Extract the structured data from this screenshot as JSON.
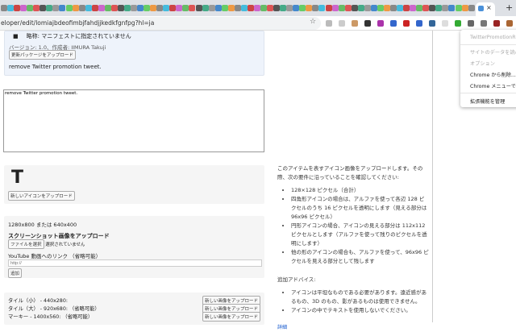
{
  "browser": {
    "url": "eloper/edit/lomiajbdeofimbjfahdjjkedkfgnfpg?hl=ja",
    "close_tab": "×",
    "new_tab": "+",
    "bookmark": "☆"
  },
  "top_panel": {
    "permission": "略称: マニフェストに指定されていません",
    "version": "バージョン: 1.0、作成者: IIMURA Takuji",
    "upload_pkg": "更新パッケージをアップロード",
    "description": "remove Twitter promotion tweet."
  },
  "textarea_value": "remove Twitter promotion tweet.",
  "icon_panel": {
    "glyph": "T",
    "upload": "新しいアイコンをアップロード"
  },
  "screenshot_panel": {
    "size": "1280x800 または 640x400",
    "heading": "スクリーンショット画像をアップロード",
    "choose_file": "ファイルを選択",
    "no_file": "選択されていません",
    "youtube_label": "YouTube 動画へのリンク （省略可能）",
    "youtube_placeholder": "http://",
    "add": "追加"
  },
  "tiles": [
    {
      "label": "タイル（小） - 440x280:",
      "button": "新しい画像をアップロード"
    },
    {
      "label": "タイル（大） - 920x680: （省略可能）",
      "button": "新しい画像をアップロード"
    },
    {
      "label": "マーキー - 1400x560: （省略可能）",
      "button": "新しい画像をアップロード"
    }
  ],
  "help": {
    "intro": "このアイテムを表すアイコン画像をアップロードします。その際、次の要件に沿っていることを確認してください:",
    "reqs": [
      "128×128 ピクセル（合計）",
      "四角形アイコンの場合は、アルファを使って各辺 128 ピクセルのうち 16 ピクセルを透明にします（見える部分は 96x96 ピクセル）",
      "円形アイコンの場合、アイコンの見える部分は 112x112 ピクセルとします（アルファを使って残りのピクセルを透明にします）",
      "他の形のアイコンの場合も、アルファを使って、96x96 ピクセルを見える部分として残します"
    ],
    "advice_title": "追加アドバイス:",
    "advice": [
      "アイコンは平坦なものである必要があります。遠近感があるもの、3D のもの、影があるものは使用できません。",
      "アイコンの中でテキストを使用しないでください。"
    ],
    "more": "詳細"
  },
  "menu": {
    "title": "TwitterPromotionR",
    "items": [
      "サイトのデータを読み",
      "オプション",
      "Chrome から削除...",
      "Chrome メニューで",
      "拡張機能を管理"
    ]
  }
}
